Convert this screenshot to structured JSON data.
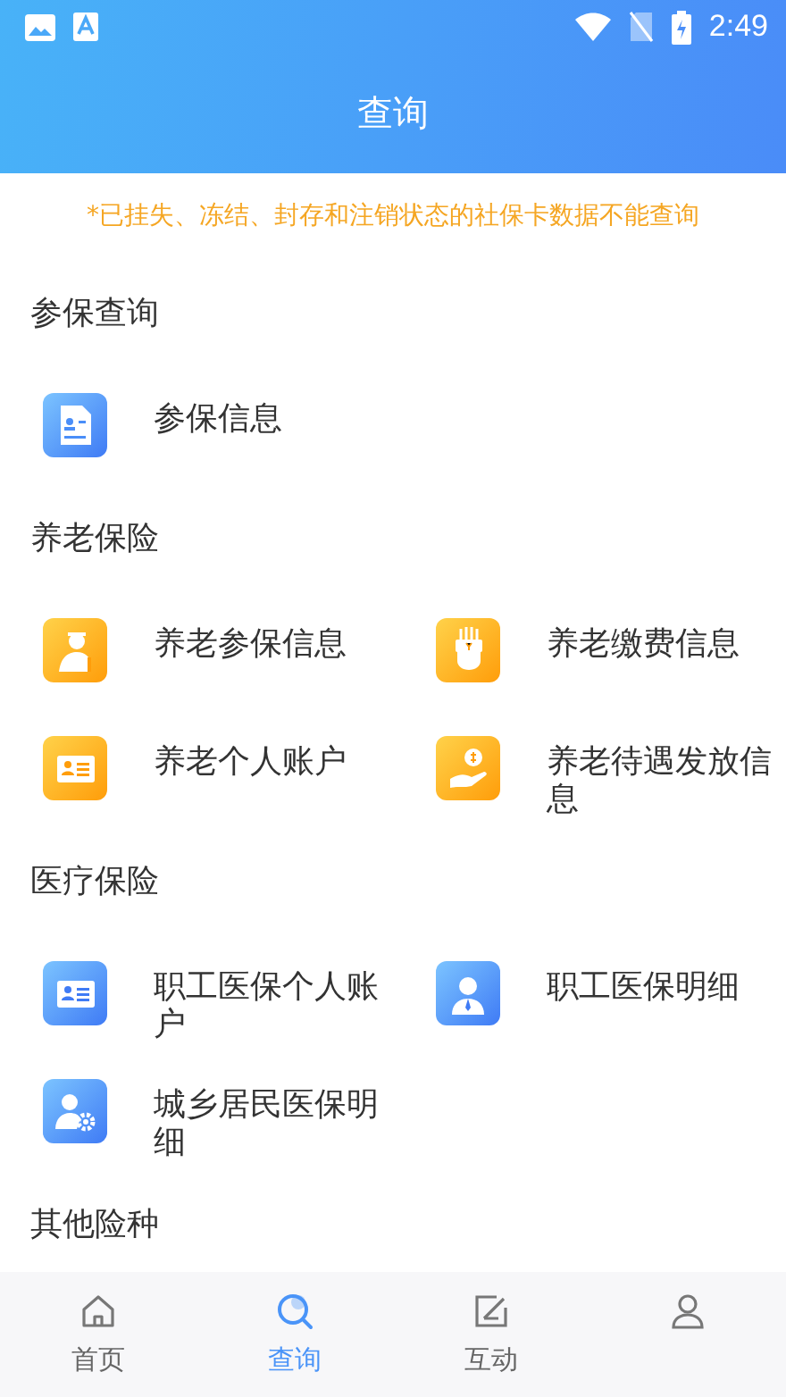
{
  "status_bar": {
    "time": "2:49"
  },
  "header": {
    "title": "查询"
  },
  "notice": "*已挂失、冻结、封存和注销状态的社保卡数据不能查询",
  "sections": [
    {
      "title": "参保查询",
      "items": [
        {
          "label": "参保信息"
        }
      ]
    },
    {
      "title": "养老保险",
      "items": [
        {
          "label": "养老参保信息"
        },
        {
          "label": "养老缴费信息"
        },
        {
          "label": "养老个人账户"
        },
        {
          "label": "养老待遇发放信息"
        }
      ]
    },
    {
      "title": "医疗保险",
      "items": [
        {
          "label": "职工医保个人账户"
        },
        {
          "label": "职工医保明细"
        },
        {
          "label": "城乡居民医保明细"
        }
      ]
    },
    {
      "title": "其他险种"
    }
  ],
  "tabs": [
    {
      "label": "首页",
      "selected": false
    },
    {
      "label": "查询",
      "selected": true
    },
    {
      "label": "互动",
      "selected": false
    },
    {
      "selected": false
    }
  ]
}
